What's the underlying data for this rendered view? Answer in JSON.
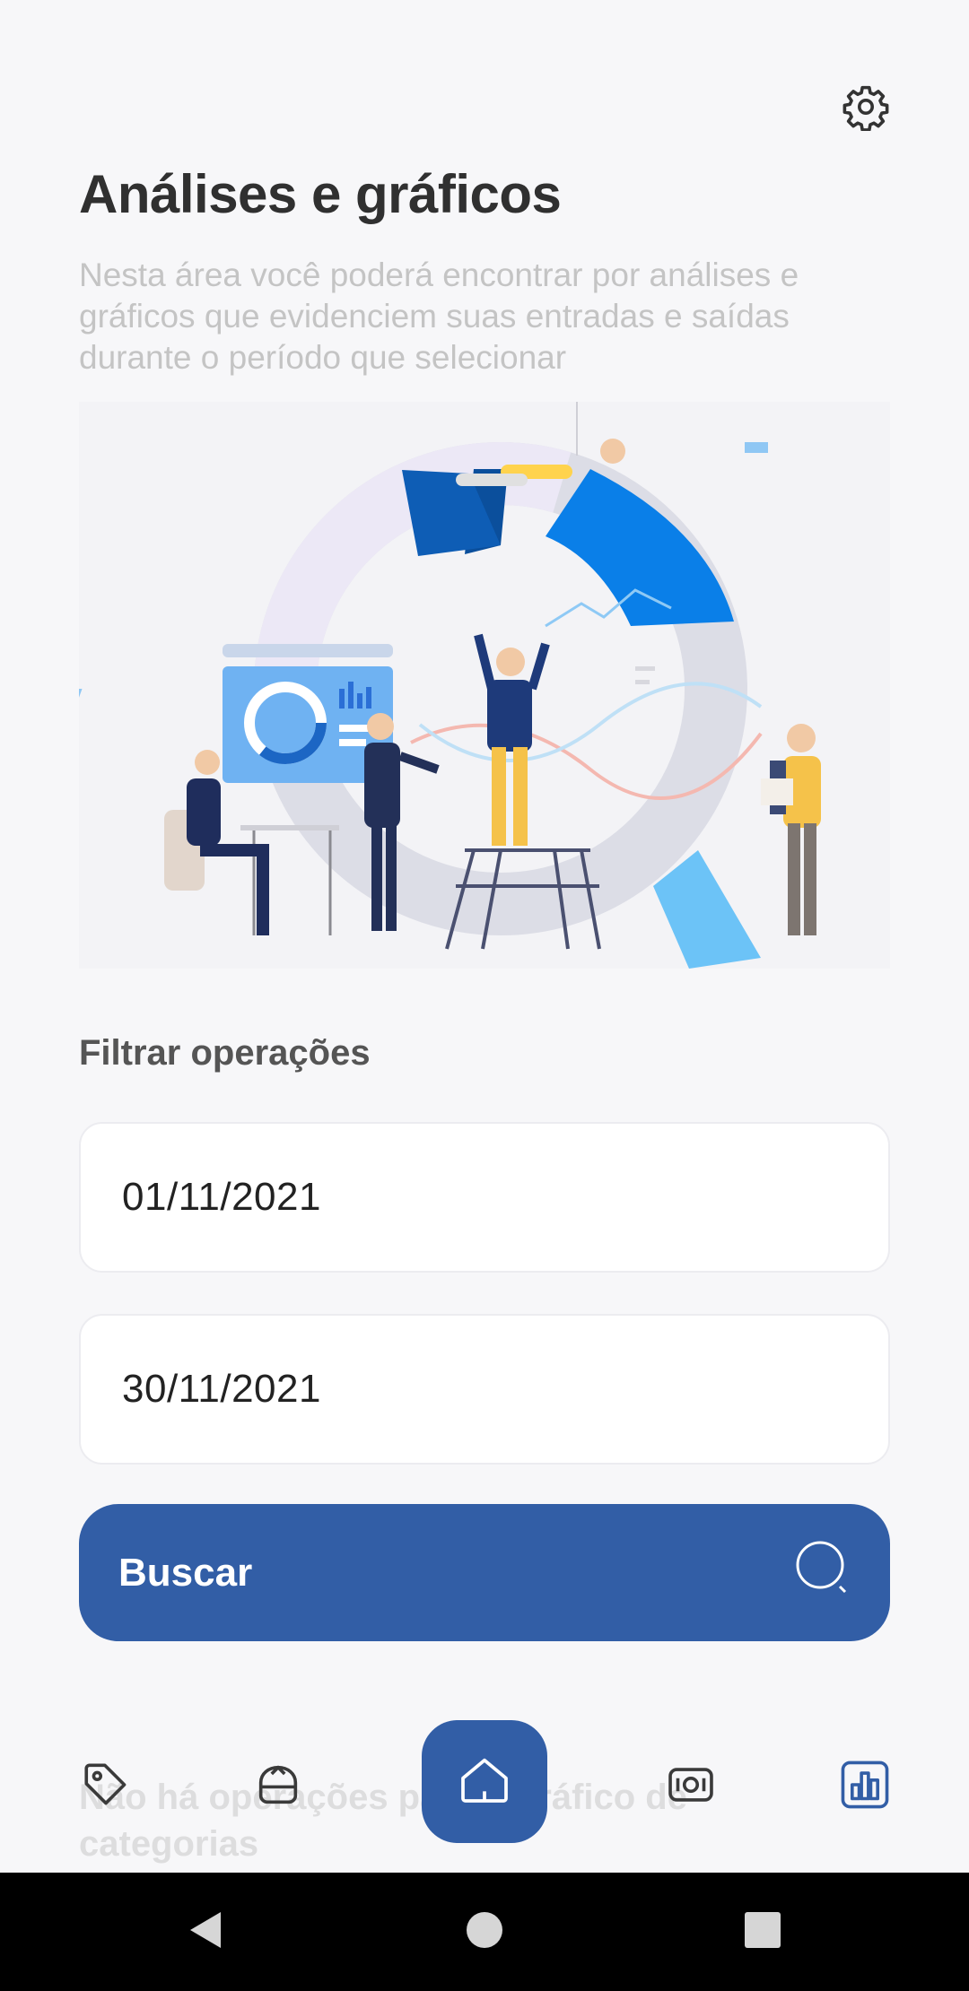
{
  "header": {
    "settings_icon": "gear-icon",
    "title": "Análises e gráficos",
    "description": "Nesta área você poderá encontrar por análises e gráficos que evidenciem suas entradas e saídas durante o período que selecionar"
  },
  "filter": {
    "title": "Filtrar operações",
    "start_date": "01/11/2021",
    "end_date": "30/11/2021",
    "search_label": "Buscar",
    "search_icon": "search-icon"
  },
  "empty_state": {
    "message": "Não há operações para o gráfico de categorias"
  },
  "bottom_nav": {
    "items": [
      {
        "icon": "tag-icon",
        "active": false
      },
      {
        "icon": "piggy-bank-icon",
        "active": false
      },
      {
        "icon": "home-icon",
        "active": true
      },
      {
        "icon": "money-bill-icon",
        "active": false
      },
      {
        "icon": "bar-chart-icon",
        "active": false
      }
    ]
  },
  "colors": {
    "primary": "#325EA6",
    "background": "#F7F7F9",
    "title": "#303030",
    "muted": "#C4C4C4"
  }
}
